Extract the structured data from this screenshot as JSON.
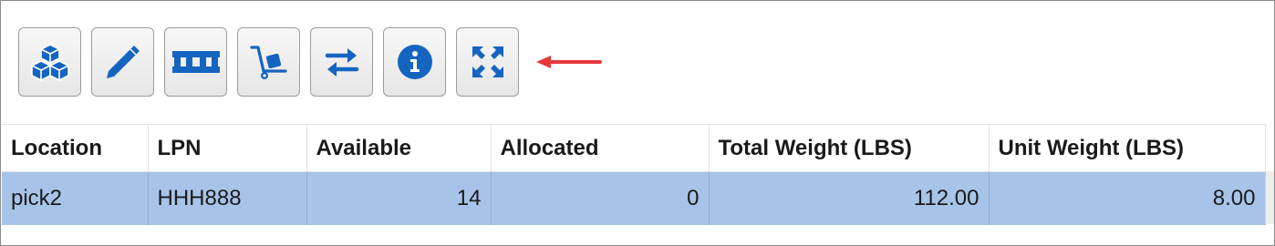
{
  "toolbar": {
    "buttons": [
      {
        "name": "inventory-button",
        "icon": "cubes-icon"
      },
      {
        "name": "edit-button",
        "icon": "pencil-icon"
      },
      {
        "name": "pallet-button",
        "icon": "pallet-icon"
      },
      {
        "name": "hand-truck-button",
        "icon": "hand-truck-icon"
      },
      {
        "name": "transfer-button",
        "icon": "exchange-arrows-icon"
      },
      {
        "name": "info-button",
        "icon": "info-circle-icon"
      },
      {
        "name": "expand-button",
        "icon": "expand-arrows-icon"
      }
    ],
    "icon_color": "#1565c0",
    "annotation_arrow_color": "#e8383d"
  },
  "grid": {
    "columns": [
      "Location",
      "LPN",
      "Available",
      "Allocated",
      "Total Weight (LBS)",
      "Unit Weight (LBS)"
    ],
    "rows": [
      {
        "location": "pick2",
        "lpn": "HHH888",
        "available": "14",
        "allocated": "0",
        "total_weight": "112.00",
        "unit_weight": "8.00",
        "selected": true
      }
    ],
    "selected_row_color": "#a7c4e8"
  }
}
